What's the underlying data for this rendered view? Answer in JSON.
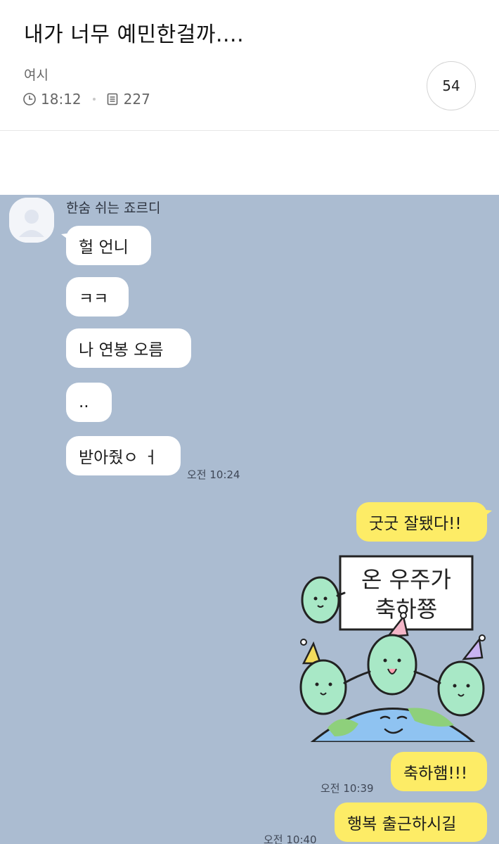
{
  "post": {
    "title": "내가 너무 예민한걸까....",
    "author": "여시",
    "time": "18:12",
    "views": "227",
    "comment_count": "54"
  },
  "chat": {
    "sender_name": "한숨 쉬는 죠르디",
    "incoming": [
      "헐 언니",
      "ㅋㅋ",
      "나 연봉 오름",
      "..",
      "받아줬ㅇ ㅓ"
    ],
    "incoming_time": "오전 10:24",
    "outgoing_1": "굿굿 잘됐다!!",
    "sticker": {
      "sign_line_1": "온 우주가",
      "sign_line_2": "축하쭁"
    },
    "outgoing_2": "축하햄!!!",
    "outgoing_2_time": "오전 10:39",
    "outgoing_3": "행복 출근하시길",
    "outgoing_3_time": "오전 10:40"
  },
  "colors": {
    "chat_background": "#abbcd1",
    "my_bubble": "#fdec66",
    "their_bubble": "#ffffff",
    "character_green": "#a8e8c6"
  },
  "icons": {
    "time": "clock-icon",
    "views": "document-icon",
    "profile": "default-profile-icon"
  }
}
